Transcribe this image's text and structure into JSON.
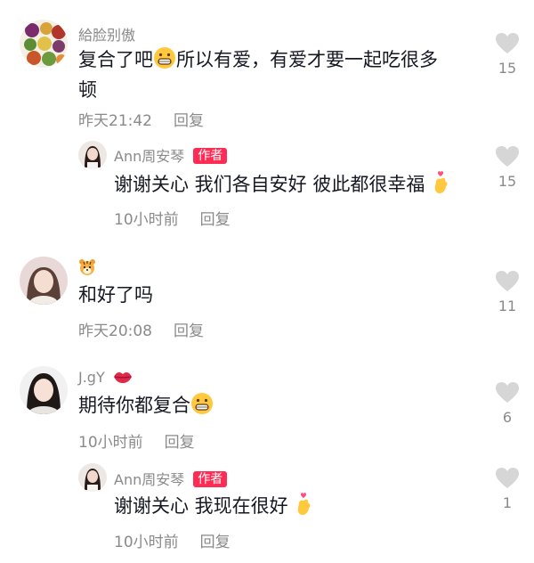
{
  "comments": [
    {
      "username": "給脸别傲",
      "text_line1_a": "复合了吧",
      "text_line1_b": "所以有爱，有爱才要一起吃很多",
      "text_line2": "顿",
      "time": "昨天21:42",
      "reply_label": "回复",
      "likes": "15",
      "reply": {
        "username": "Ann周安琴",
        "badge": "作者",
        "text": "谢谢关心 我们各自安好 彼此都很幸福",
        "time": "10小时前",
        "reply_label": "回复",
        "likes": "15"
      }
    },
    {
      "username": "",
      "text": "和好了吗",
      "time": "昨天20:08",
      "reply_label": "回复",
      "likes": "11"
    },
    {
      "username": "J.gY",
      "text": "期待你都复合",
      "time": "10小时前",
      "reply_label": "回复",
      "likes": "6",
      "reply": {
        "username": "Ann周安琴",
        "badge": "作者",
        "text": "谢谢关心 我现在很好",
        "time": "10小时前",
        "reply_label": "回复",
        "likes": "1"
      }
    }
  ],
  "colors": {
    "muted": "#8a8a8a",
    "text": "#161823",
    "badge": "#fe2c55",
    "heart": "#d6d6d6"
  }
}
